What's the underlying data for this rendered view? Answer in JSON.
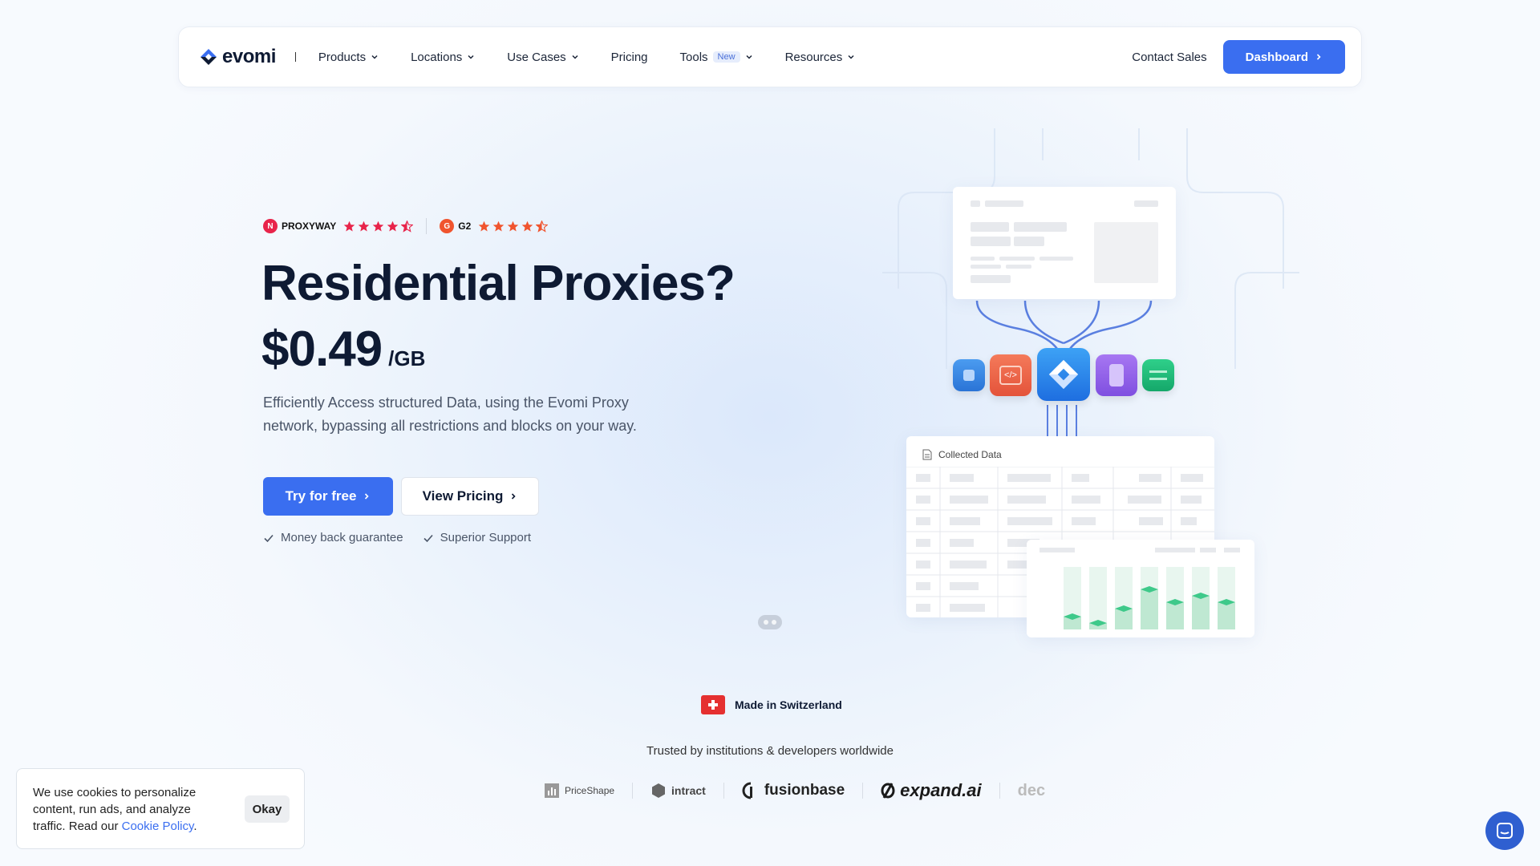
{
  "nav": {
    "logo_text": "evomi",
    "items": [
      {
        "label": "Products",
        "dropdown": true
      },
      {
        "label": "Locations",
        "dropdown": true
      },
      {
        "label": "Use Cases",
        "dropdown": true
      },
      {
        "label": "Pricing",
        "dropdown": false
      },
      {
        "label": "Tools",
        "dropdown": true,
        "badge": "New"
      },
      {
        "label": "Resources",
        "dropdown": true
      }
    ],
    "contact_label": "Contact Sales",
    "dashboard_label": "Dashboard"
  },
  "ratings": [
    {
      "name": "PROXYWAY",
      "stars": 4.5,
      "color": "#e8244a"
    },
    {
      "name": "G2",
      "stars": 4.5,
      "color": "#f0542e"
    }
  ],
  "hero": {
    "title": "Residential Proxies?",
    "price": "$0.49",
    "price_unit": "/GB",
    "description": "Efficiently Access structured Data, using the Evomi Proxy network, bypassing all restrictions and blocks on your way.",
    "try_label": "Try for free",
    "view_label": "View Pricing",
    "checks": [
      "Money back guarantee",
      "Superior Support"
    ]
  },
  "illustration": {
    "collected_title": "Collected Data"
  },
  "made_in": "Made in Switzerland",
  "trusted_text": "Trusted by institutions & developers worldwide",
  "brands": [
    "PriceShape",
    "intract",
    "fusionbase",
    "expand.ai",
    "dec"
  ],
  "cookie": {
    "text": "We use cookies to personalize content, run ads, and analyze traffic. Read our ",
    "link": "Cookie Policy",
    "after": ".",
    "okay_label": "Okay"
  },
  "colors": {
    "accent": "#3a6ef0",
    "heading": "#0e1a33",
    "star_red": "#e8244a",
    "star_orange": "#f0542e"
  }
}
